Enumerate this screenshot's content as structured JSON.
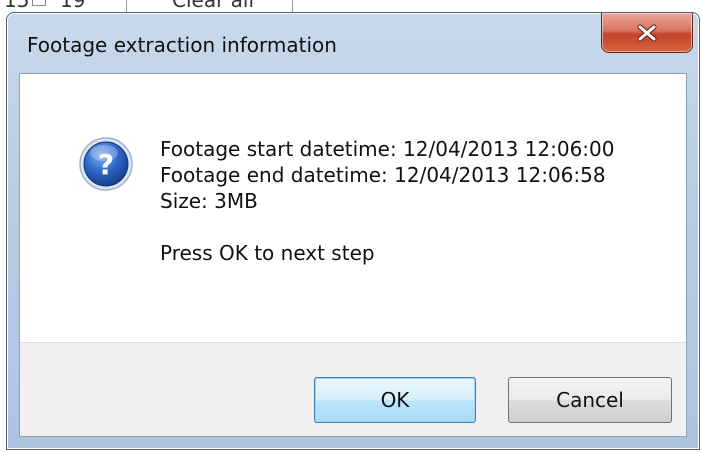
{
  "background": {
    "fragment_left": "15",
    "fragment_mid": "19",
    "fragment_link": "Clear all"
  },
  "dialog": {
    "title": "Footage extraction information",
    "icon": "question-icon",
    "message": {
      "start": "Footage start datetime: 12/04/2013 12:06:00",
      "end": "Footage end datetime: 12/04/2013 12:06:58",
      "size": "Size: 3MB",
      "prompt": "Press OK to next step"
    },
    "buttons": {
      "ok": "OK",
      "cancel": "Cancel"
    }
  },
  "colors": {
    "accent": "#3c7fb1",
    "close_red": "#c3432c",
    "icon_blue": "#1f56b6"
  }
}
